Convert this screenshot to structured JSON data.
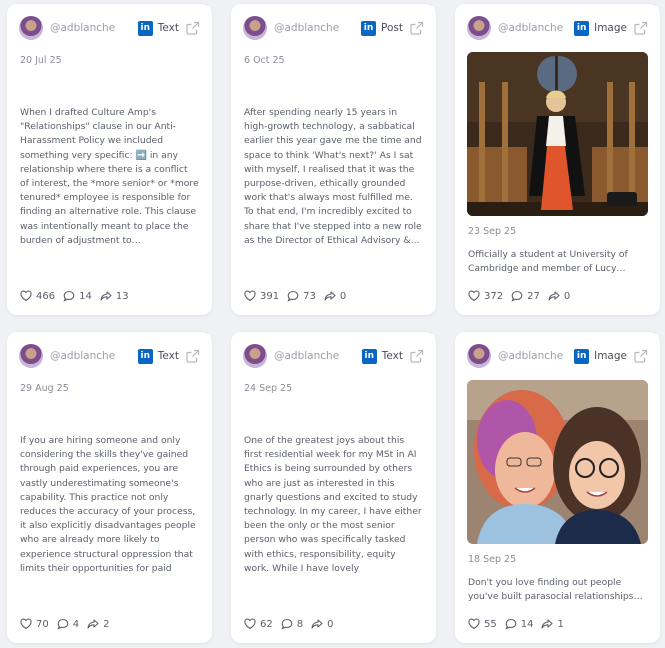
{
  "cards": [
    {
      "handle": "@adblanche",
      "platform_icon": "linkedin-icon",
      "type": "Text",
      "date": "20 Jul 25",
      "text": "When I drafted Culture Amp's \"Relationships\" clause in our Anti-Harassment Policy we included something very specific: ➡️ in any relationship where there is a conflict of interest, the *more senior* or *more tenured* employee is responsible for finding an alternative role. This clause was intentionally meant to place the burden of adjustment to…",
      "likes": "466",
      "comments": "14",
      "shares": "13"
    },
    {
      "handle": "@adblanche",
      "platform_icon": "linkedin-icon",
      "type": "Post",
      "date": "6 Oct 25",
      "text": "After spending nearly 15 years in high-growth technology, a sabbatical earlier this year gave me the time and space to think 'What's next?' As I sat with myself, I realised that it was the purpose-driven, ethically grounded work that's always most fulfilled me. To that end, I'm incredibly excited to share that I've stepped into a new role as the Director of Ethical Advisory &…",
      "likes": "391",
      "comments": "73",
      "shares": "0"
    },
    {
      "handle": "@adblanche",
      "platform_icon": "linkedin-icon",
      "type": "Image",
      "date": "23 Sep 25",
      "text": "Officially a student at University of Cambridge and member of Lucy…",
      "likes": "372",
      "comments": "27",
      "shares": "0"
    },
    {
      "handle": "@adblanche",
      "platform_icon": "linkedin-icon",
      "type": "Text",
      "date": "29 Aug 25",
      "text": "If you are hiring someone and only considering the skills they've gained through paid experiences, you are vastly underestimating someone's capability. This practice not only reduces the accuracy of your process, it also explicitly disadvantages people who are already more likely to experience structural oppression that limits their opportunities for paid work.",
      "likes": "70",
      "comments": "4",
      "shares": "2"
    },
    {
      "handle": "@adblanche",
      "platform_icon": "linkedin-icon",
      "type": "Text",
      "date": "24 Sep 25",
      "text": "One of the greatest joys about this first residential week for my MSt in AI Ethics is being surrounded by others who are just as interested in this gnarly questions and excited to study technology. In my career, I have either been the only or the most senior person who was specifically tasked with ethics, responsibility, equity work. While I have lovely communities, it als…",
      "likes": "62",
      "comments": "8",
      "shares": "0"
    },
    {
      "handle": "@adblanche",
      "platform_icon": "linkedin-icon",
      "type": "Image",
      "date": "18 Sep 25",
      "text": "Don't you love finding out people you've built parasocial relationships…",
      "likes": "55",
      "comments": "14",
      "shares": "1"
    }
  ],
  "colors": {
    "linkedin": "#0a66c2",
    "card_bg": "#ffffff",
    "page_bg": "#f0f1f4"
  }
}
